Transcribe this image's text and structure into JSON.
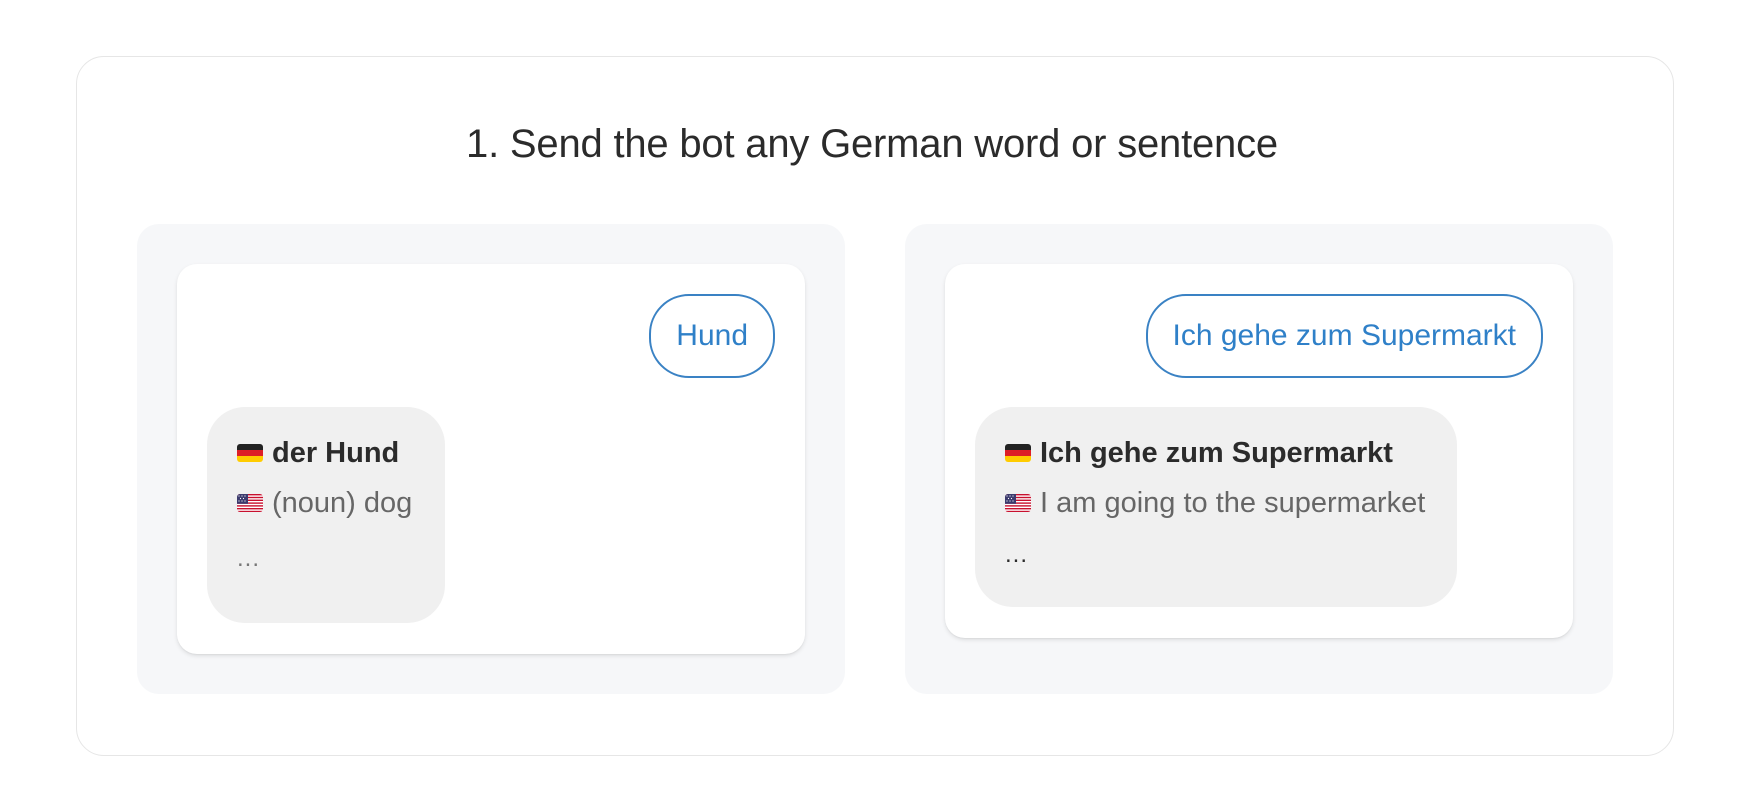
{
  "title": "1. Send the bot any German word or sentence",
  "examples": [
    {
      "user_message": "Hund",
      "reply": {
        "german": "der Hund",
        "english": "(noun) dog",
        "more": "..."
      }
    },
    {
      "user_message": "Ich gehe zum Supermarkt",
      "reply": {
        "german": "Ich gehe zum Supermarkt",
        "english": "I am going to the supermarket",
        "more": "..."
      }
    }
  ],
  "icons": {
    "german": "germany-flag-icon",
    "english": "us-flag-icon"
  },
  "colors": {
    "accent": "#2f80c8",
    "bubble_border": "#3a82c4",
    "reply_background": "#f0f0f0",
    "panel_background": "#f6f7f9"
  }
}
